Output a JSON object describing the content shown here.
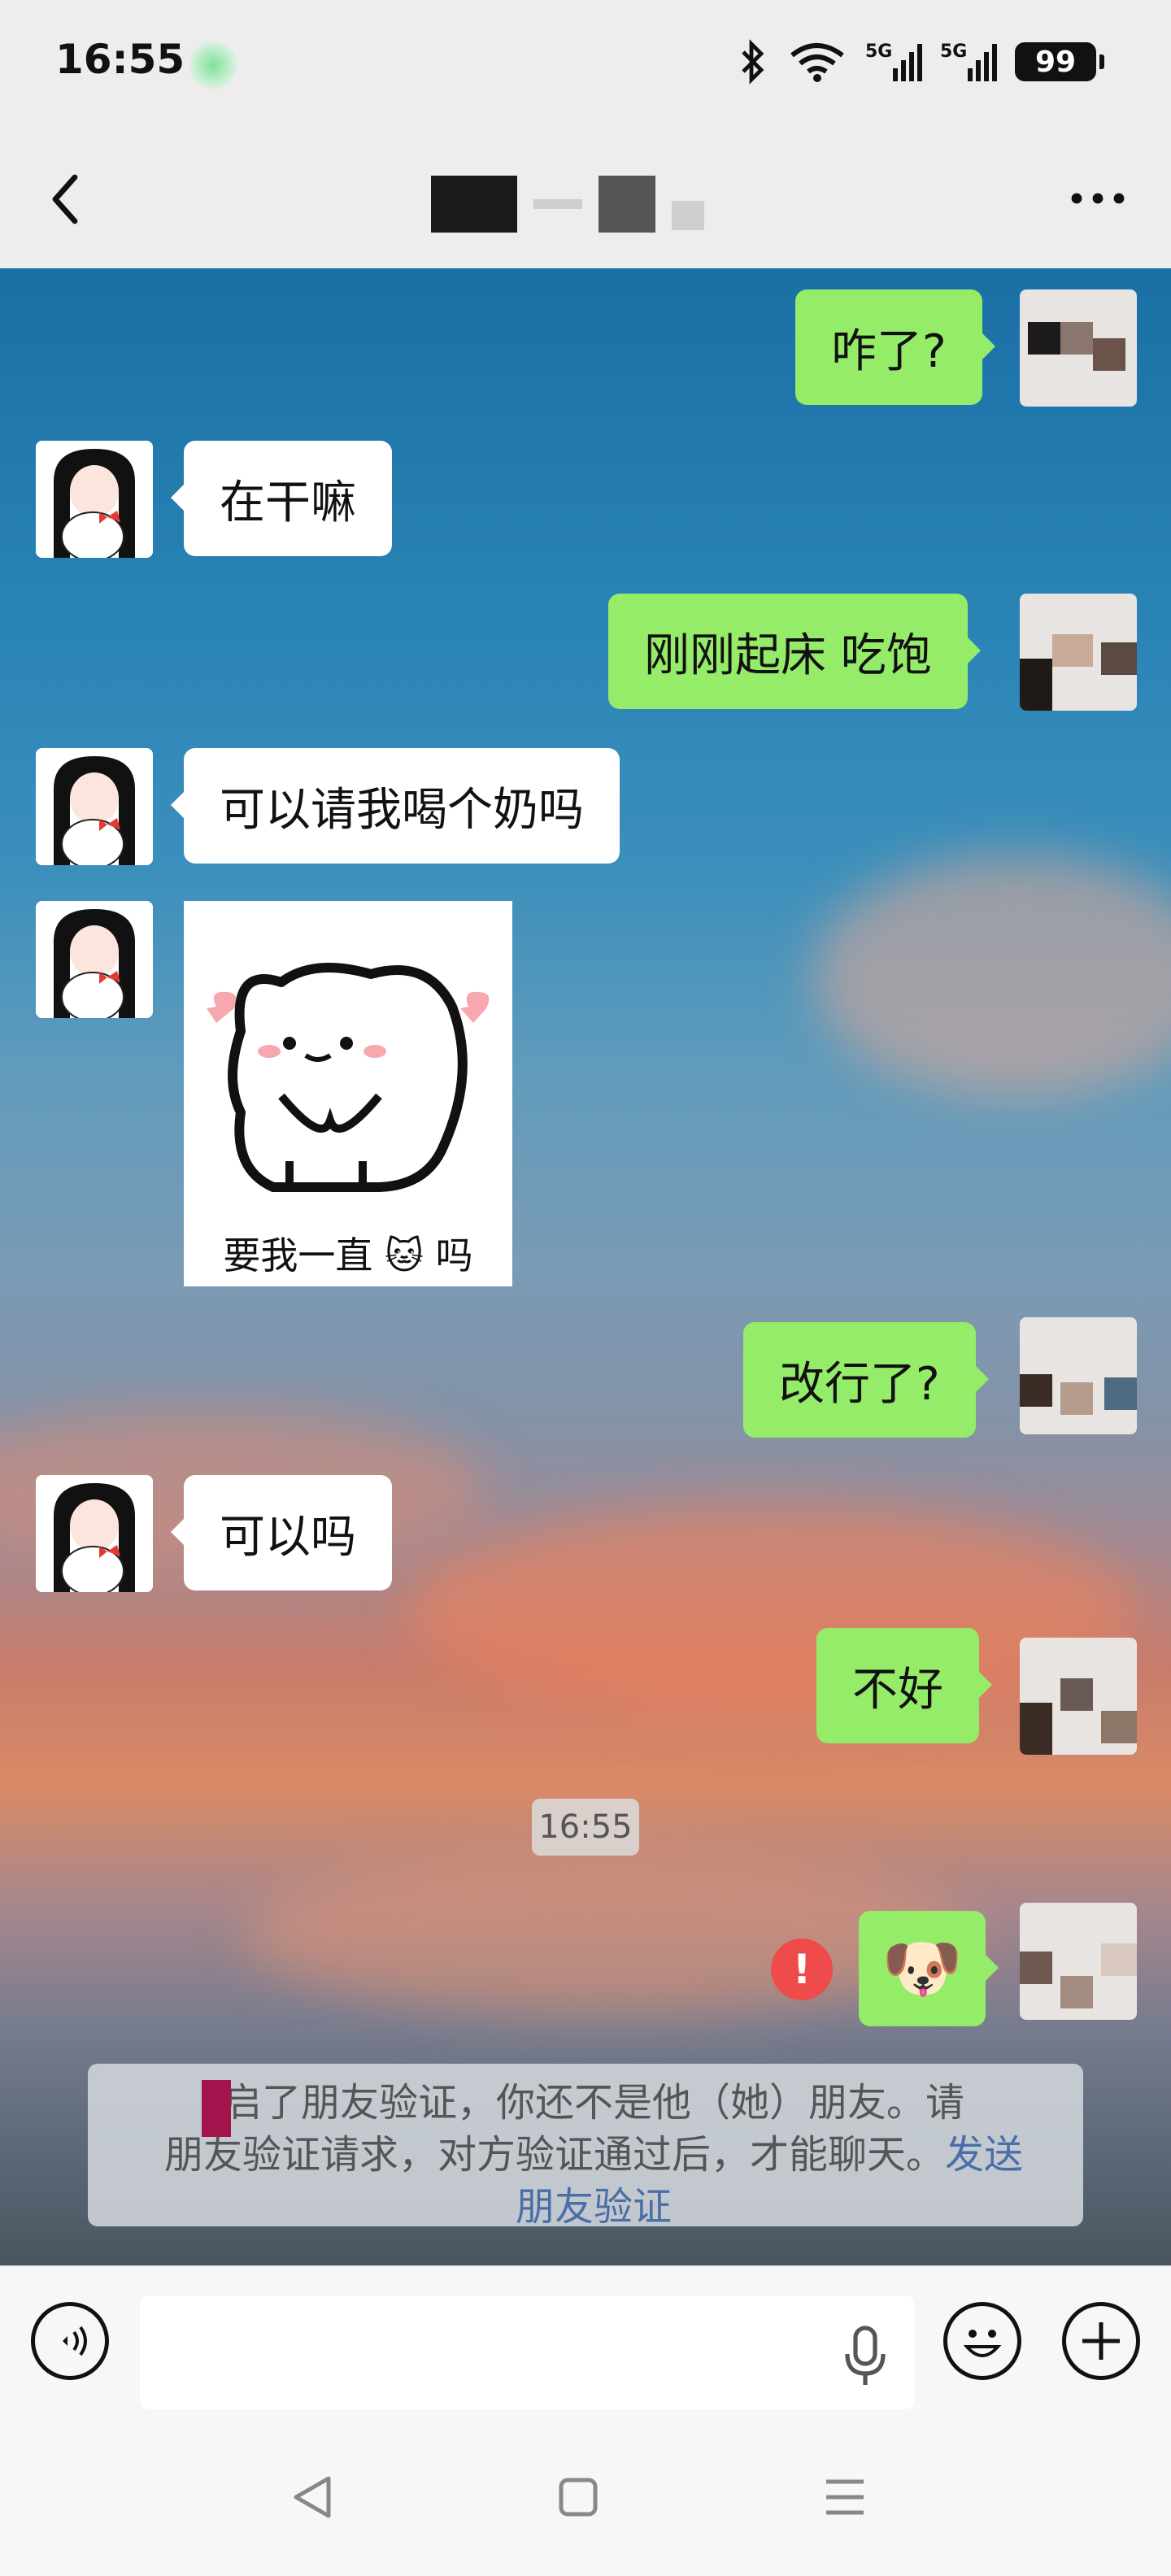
{
  "status_bar": {
    "time": "16:55",
    "battery": "99",
    "network": "5G"
  },
  "nav": {
    "back_icon": "chevron-left-icon",
    "more_icon": "more-dots-icon"
  },
  "messages": [
    {
      "side": "out",
      "text": "咋了?"
    },
    {
      "side": "in",
      "text": "在干嘛"
    },
    {
      "side": "out",
      "text": "刚刚起床 吃饱"
    },
    {
      "side": "in",
      "text": "可以请我喝个奶吗"
    },
    {
      "side": "in",
      "type": "sticker",
      "caption_before": "要我一直",
      "caption_after": "吗"
    },
    {
      "side": "out",
      "text": "改行了?"
    },
    {
      "side": "in",
      "text": "可以吗"
    },
    {
      "side": "out",
      "text": "不好"
    },
    {
      "side": "out",
      "type": "emoji",
      "emoji": "🐶",
      "failed": true
    }
  ],
  "timestamp": "16:55",
  "system_notice": {
    "text": "启了朋友验证，你还不是他（她）朋友。请",
    "text2": "朋友验证请求，对方验证通过后，才能聊天。",
    "link_inline": "发送",
    "link": "朋友验证"
  },
  "input": {
    "placeholder": "",
    "fail_icon": "!"
  },
  "colors": {
    "bubble_out": "#95ec69",
    "bubble_in": "#ffffff",
    "link": "#4a6ea8",
    "error": "#f04b4b"
  }
}
